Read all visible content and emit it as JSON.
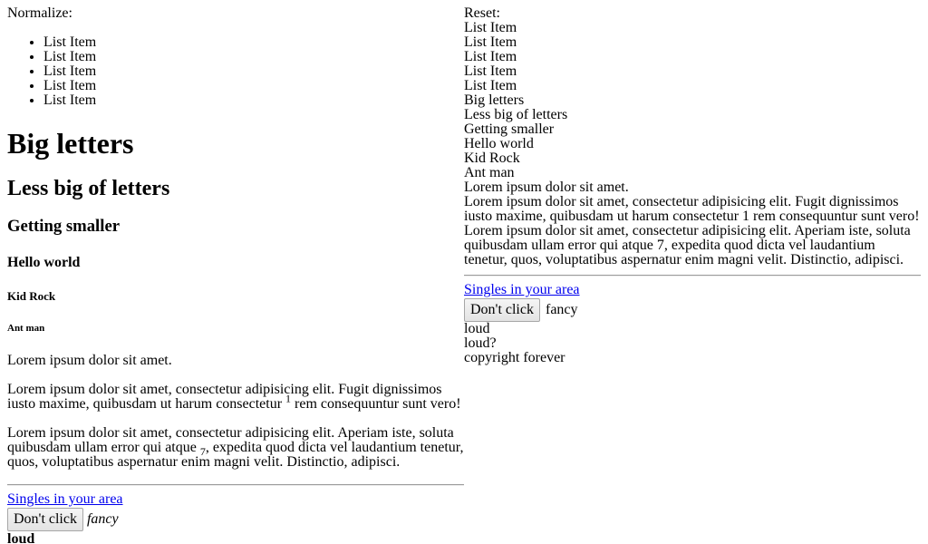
{
  "normalize": {
    "title": "Normalize:",
    "list_items": [
      "List Item",
      "List Item",
      "List Item",
      "List Item",
      "List Item"
    ],
    "h1": "Big letters",
    "h2": "Less big of letters",
    "h3": "Getting smaller",
    "h4": "Hello world",
    "h5": "Kid Rock",
    "h6": "Ant man",
    "p1": "Lorem ipsum dolor sit amet.",
    "p2_before": "Lorem ipsum dolor sit amet, consectetur adipisicing elit. Fugit dignissimos iusto maxime, quibusdam ut harum consectetur ",
    "p2_sup": "1",
    "p2_after": " rem consequuntur sunt vero!",
    "p3_before": "Lorem ipsum dolor sit amet, consectetur adipisicing elit. Aperiam iste, soluta quibusdam ullam error qui atque ",
    "p3_sub": "7",
    "p3_after": ", expedita quod dicta vel laudantium tenetur, quos, voluptatibus aspernatur enim magni velit. Distinctio, adipisci.",
    "link": "Singles in your area",
    "button": "Don't click",
    "fancy": "fancy",
    "loud": "loud"
  },
  "reset": {
    "title": "Reset:",
    "list_items": [
      "List Item",
      "List Item",
      "List Item",
      "List Item",
      "List Item"
    ],
    "h1": "Big letters",
    "h2": "Less big of letters",
    "h3": "Getting smaller",
    "h4": "Hello world",
    "h5": "Kid Rock",
    "h6": "Ant man",
    "p1": "Lorem ipsum dolor sit amet.",
    "p2": "Lorem ipsum dolor sit amet, consectetur adipisicing elit. Fugit dignissimos iusto maxime, quibusdam ut harum consectetur 1 rem consequuntur sunt vero!",
    "p3": "Lorem ipsum dolor sit amet, consectetur adipisicing elit. Aperiam iste, soluta quibusdam ullam error qui atque 7, expedita quod dicta vel laudantium tenetur, quos, voluptatibus aspernatur enim magni velit. Distinctio, adipisci.",
    "link": "Singles in your area",
    "button": "Don't click",
    "fancy": "fancy",
    "loud": "loud",
    "loud_q": "loud?",
    "copyright": "copyright forever"
  }
}
